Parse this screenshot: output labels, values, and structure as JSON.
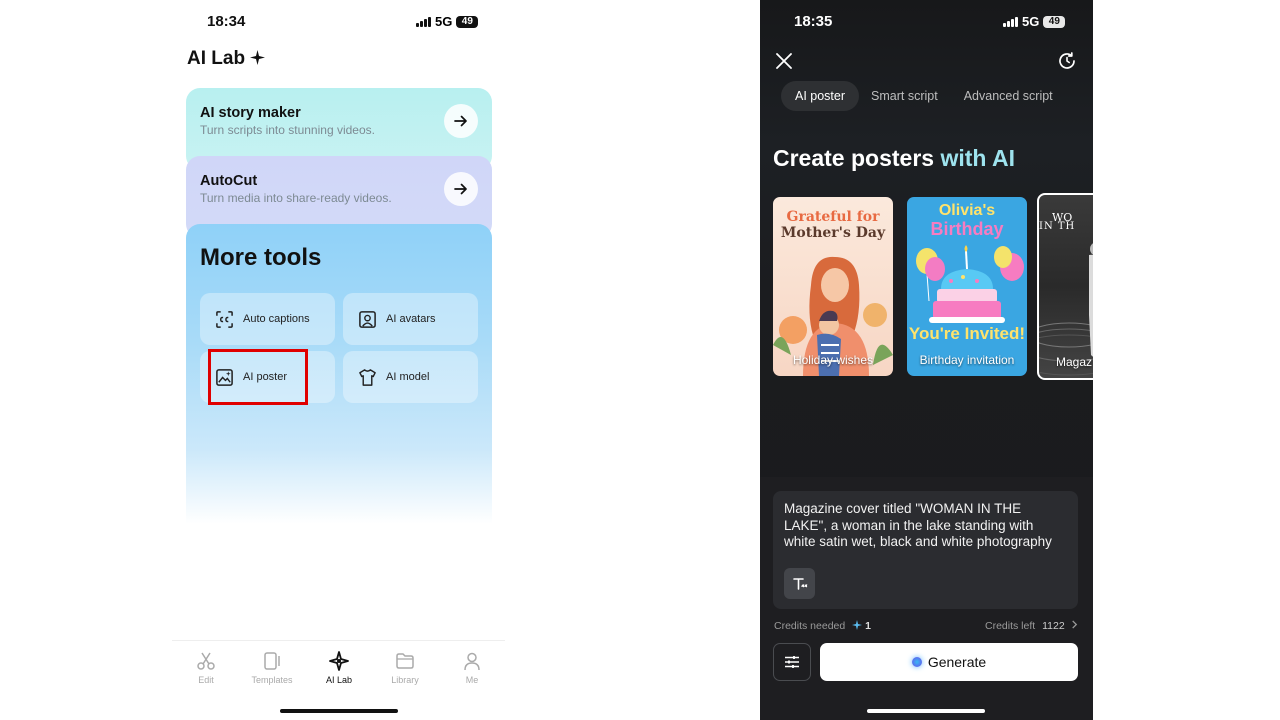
{
  "left": {
    "status": {
      "time": "18:34",
      "network": "5G",
      "battery": "49"
    },
    "title": "AI Lab",
    "cards": [
      {
        "title": "AI story maker",
        "subtitle": "Turn scripts into stunning videos."
      },
      {
        "title": "AutoCut",
        "subtitle": "Turn media into share-ready videos."
      }
    ],
    "more_tools": {
      "title": "More tools",
      "items": [
        {
          "label": "Auto captions",
          "icon": "captions-icon"
        },
        {
          "label": "AI avatars",
          "icon": "avatar-icon"
        },
        {
          "label": "AI poster",
          "icon": "poster-icon"
        },
        {
          "label": "AI model",
          "icon": "tshirt-icon"
        }
      ]
    },
    "tabbar": [
      {
        "label": "Edit",
        "icon": "scissors-icon"
      },
      {
        "label": "Templates",
        "icon": "templates-icon"
      },
      {
        "label": "AI Lab",
        "icon": "ai-lab-icon",
        "active": true
      },
      {
        "label": "Library",
        "icon": "folder-icon"
      },
      {
        "label": "Me",
        "icon": "person-icon"
      }
    ]
  },
  "right": {
    "status": {
      "time": "18:35",
      "network": "5G",
      "battery": "49"
    },
    "tabs": [
      "AI poster",
      "Smart script",
      "Advanced script"
    ],
    "active_tab": "AI poster",
    "headline": {
      "part1": "Create posters ",
      "part2": "with AI"
    },
    "accent_color": "#9ee3ee",
    "posters": [
      {
        "art_text_1": "Grateful for",
        "art_text_2": "Mother's Day",
        "caption": "Holiday wishes"
      },
      {
        "art_text_1": "Olivia's",
        "art_text_2": "Birthday",
        "art_text_3": "You're Invited!",
        "caption": "Birthday invitation"
      },
      {
        "art_text_1": "WO",
        "art_text_2": "IN TH",
        "caption": "Magaz"
      }
    ],
    "prompt_text": "Magazine cover titled \"WOMAN IN THE LAKE\", a woman in the lake standing with white satin wet, black and white photography",
    "credits_needed_label": "Credits needed",
    "credits_needed_value": "1",
    "credits_left_label": "Credits left",
    "credits_left_value": "1122",
    "generate_label": "Generate"
  }
}
